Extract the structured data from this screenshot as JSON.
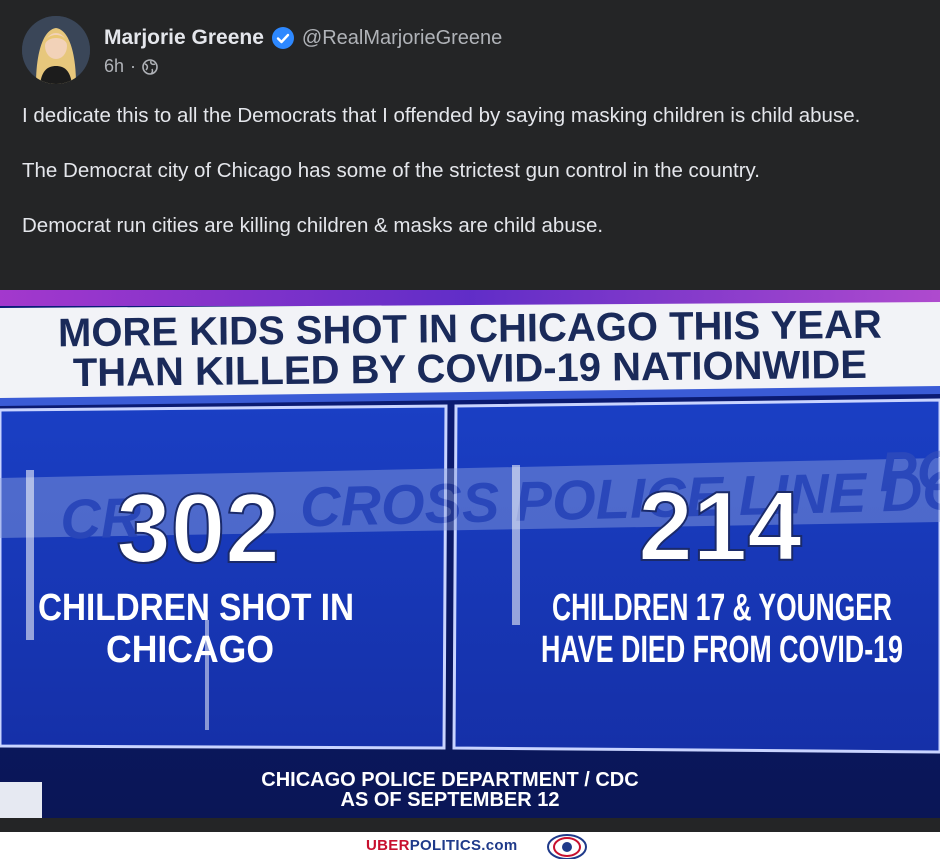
{
  "post": {
    "author_name": "Marjorie Greene",
    "handle": "@RealMarjorieGreene",
    "time": "6h",
    "separator": "·",
    "paragraphs": [
      "I dedicate this to all the Democrats that I offended by saying masking children is child abuse.",
      "The Democrat city of Chicago has some of the strictest gun control in the country.",
      "Democrat run cities are killing children & masks are child abuse."
    ]
  },
  "graphic": {
    "headline_line1": "MORE KIDS SHOT IN CHICAGO THIS YEAR",
    "headline_line2": "THAN KILLED BY COVID-19 NATIONWIDE",
    "left_number": "302",
    "left_caption_line1": "CHILDREN SHOT IN",
    "left_caption_line2": "CHICAGO",
    "right_number": "214",
    "right_caption_line1": "CHILDREN 17 & YOUNGER",
    "right_caption_line2": "HAVE DIED FROM COVID-19",
    "source_line1": "CHICAGO POLICE DEPARTMENT / CDC",
    "source_line2": "AS OF SEPTEMBER 12",
    "tape_text": "CROSS POLICE LINE DO NOT CROSS",
    "tape_text_right": "POL",
    "tape_text_left": "CR"
  },
  "watermark": {
    "uber": "UBER",
    "politics": "POLITICS",
    "com": ".com"
  },
  "icons": {
    "verified": "verified-badge-icon",
    "audience": "globe-icon",
    "logo": "uberpolitics-logo-icon"
  },
  "colors": {
    "post_background": "#242526",
    "verified_blue": "#2d88ff",
    "graphic_blue": "#1633b8",
    "headline_text": "#1a2a5a",
    "site_red": "#c8102e",
    "site_blue": "#1f3a8a"
  }
}
